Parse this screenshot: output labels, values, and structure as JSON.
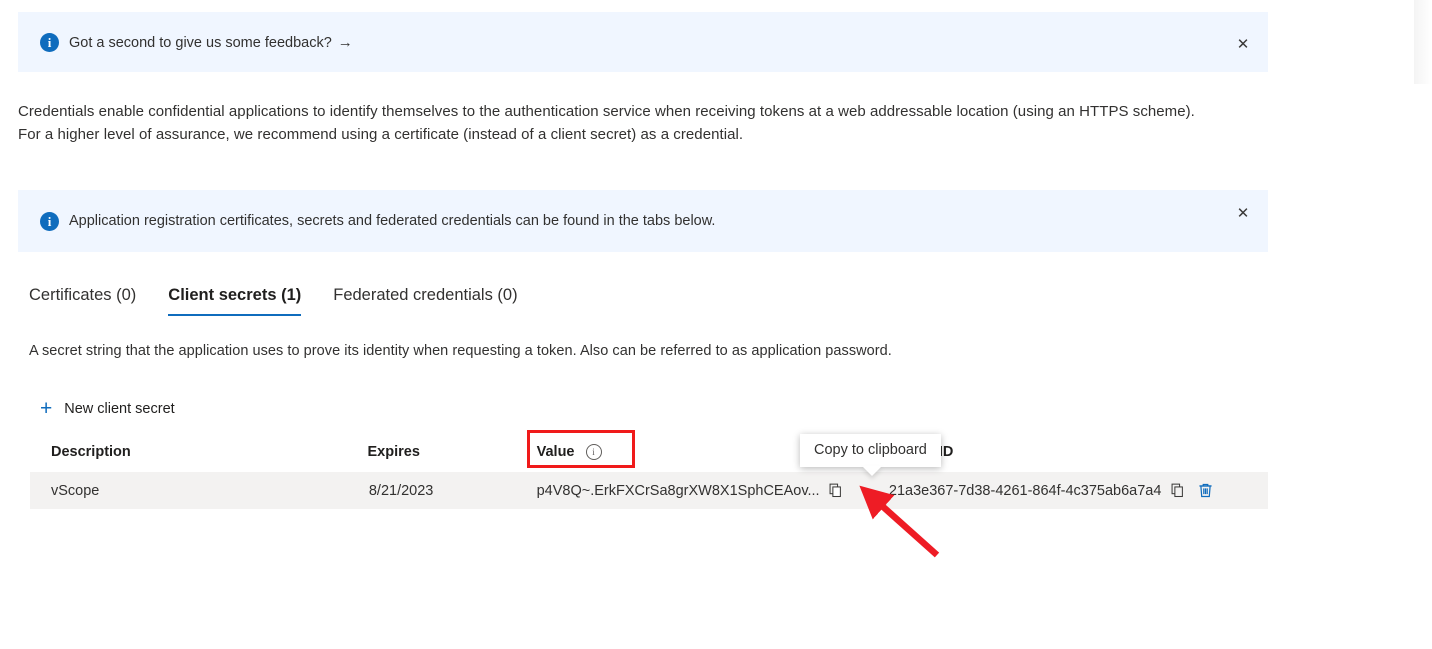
{
  "banners": [
    {
      "icon": "info-icon",
      "text": "Got a second to give us some feedback?",
      "arrow": "→",
      "close_label": "✕"
    },
    {
      "icon": "info-icon",
      "text": "Application registration certificates, secrets and federated credentials can be found in the tabs below.",
      "close_label": "✕"
    }
  ],
  "intro_paragraph": "Credentials enable confidential applications to identify themselves to the authentication service when receiving tokens at a web addressable location (using an HTTPS scheme). For a higher level of assurance, we recommend using a certificate (instead of a client secret) as a credential.",
  "tabs": [
    {
      "label": "Certificates (0)",
      "selected": false
    },
    {
      "label": "Client secrets (1)",
      "selected": true
    },
    {
      "label": "Federated credentials (0)",
      "selected": false
    }
  ],
  "secrets_description": "A secret string that the application uses to prove its identity when requesting a token. Also can be referred to as application password.",
  "commands": {
    "new_client_secret": "New client secret",
    "plus_icon": "+"
  },
  "table": {
    "headers": {
      "description": "Description",
      "expires": "Expires",
      "value": "Value",
      "value_info_icon": "i",
      "secret_id": "Secret ID"
    },
    "rows": [
      {
        "description": "vScope",
        "expires": "8/21/2023",
        "value": "p4V8Q~.ErkFXCrSa8grXW8X1SphCEAov...",
        "value_copy_icon": "copy-icon",
        "secret_id": "21a3e367-7d38-4261-864f-4c375ab6a7a4",
        "secret_id_copy_icon": "copy-icon",
        "delete_icon": "trash-icon"
      }
    ]
  },
  "tooltip": {
    "text": "Copy to clipboard"
  },
  "annotations": {
    "highlight_target": "Value",
    "arrow_color": "#ee1c25",
    "highlight_color": "#f01a1a"
  },
  "colors": {
    "accent": "#0f6cbd",
    "banner_background": "#f0f6ff",
    "row_background": "#f3f2f1",
    "text": "#323130"
  }
}
